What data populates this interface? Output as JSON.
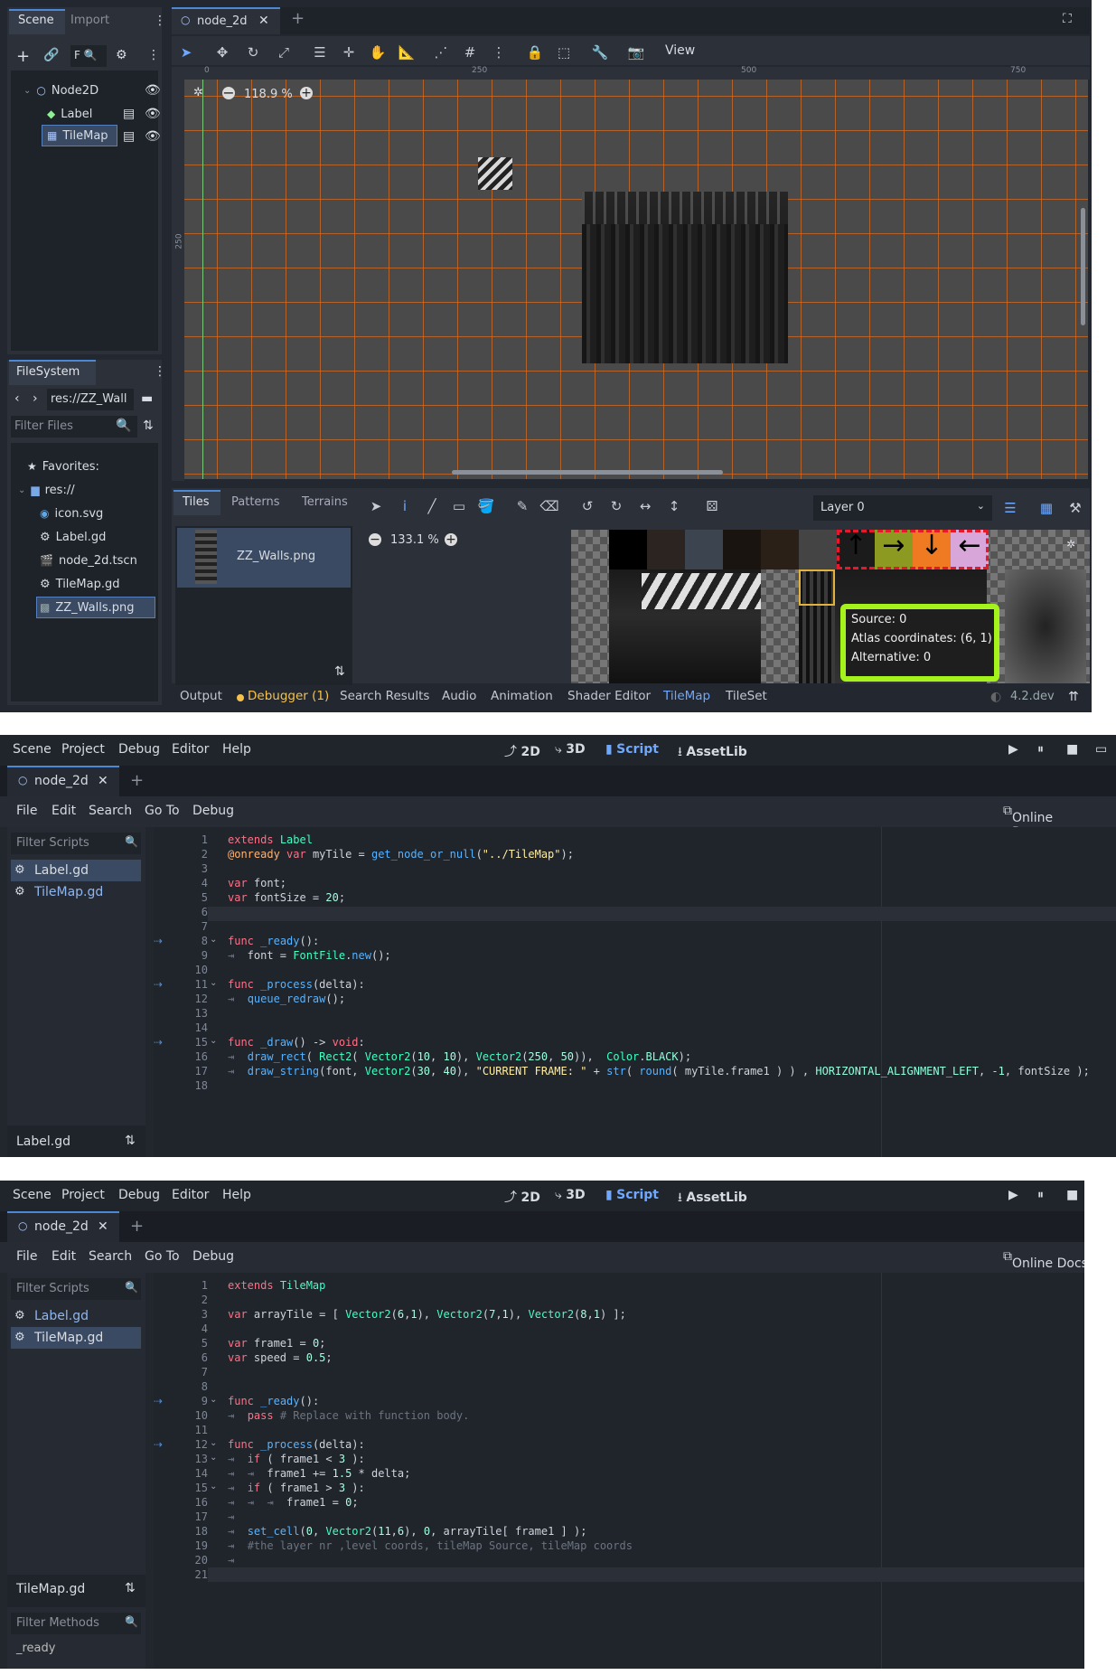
{
  "panel1": {
    "scene_dock": {
      "tabs": [
        "Scene",
        "Import"
      ],
      "filter": "F"
    },
    "scene_tree": [
      {
        "label": "Node2D",
        "icon": "circle-node-icon"
      },
      {
        "label": "Label",
        "icon": "label-icon"
      },
      {
        "label": "TileMap",
        "icon": "tilemap-icon"
      }
    ],
    "filesystem": {
      "title": "FileSystem",
      "path": "res://ZZ_Wall",
      "filter_placeholder": "Filter Files",
      "items": [
        {
          "label": "Favorites:",
          "icon": "star-icon"
        },
        {
          "label": "res://",
          "icon": "folder-icon"
        },
        {
          "label": "icon.svg",
          "icon": "svg-icon"
        },
        {
          "label": "Label.gd",
          "icon": "gear-icon"
        },
        {
          "label": "node_2d.tscn",
          "icon": "scene-icon"
        },
        {
          "label": "TileMap.gd",
          "icon": "gear-icon"
        },
        {
          "label": "ZZ_Walls.png",
          "icon": "image-icon"
        }
      ]
    },
    "editor_tab": "node_2d",
    "toolbar": {
      "view_label": "View"
    },
    "viewport": {
      "zoom": "118.9 %",
      "ruler": [
        "0",
        "250",
        "500",
        "750"
      ],
      "ruler_v": "250"
    },
    "tilemap_panel": {
      "tabs": [
        "Tiles",
        "Patterns",
        "Terrains"
      ],
      "layer": "Layer 0",
      "source": "ZZ_Walls.png",
      "zoom": "133.1 %",
      "tooltip": {
        "source": "Source: 0",
        "atlas": "Atlas coordinates: (6, 1)",
        "alt": "Alternative: 0"
      }
    },
    "bottom_tabs": [
      "Output",
      "Debugger (1)",
      "Search Results",
      "Audio",
      "Animation",
      "Shader Editor",
      "TileMap",
      "TileSet"
    ],
    "version": "4.2.dev"
  },
  "menu": {
    "items": [
      "Scene",
      "Project",
      "Debug",
      "Editor",
      "Help"
    ],
    "workspaces": [
      "2D",
      "3D",
      "Script",
      "AssetLib"
    ]
  },
  "script_menu": {
    "items": [
      "File",
      "Edit",
      "Search",
      "Go To",
      "Debug"
    ],
    "online_docs": "Online Docs",
    "filter_placeholder": "Filter Scripts",
    "methods_placeholder": "Filter Methods"
  },
  "scripts": [
    "Label.gd",
    "TileMap.gd"
  ],
  "panel2": {
    "tab": "node_2d",
    "current": "Label.gd"
  },
  "panel3": {
    "tab": "node_2d",
    "current": "TileMap.gd",
    "method_partial": "_ready"
  }
}
